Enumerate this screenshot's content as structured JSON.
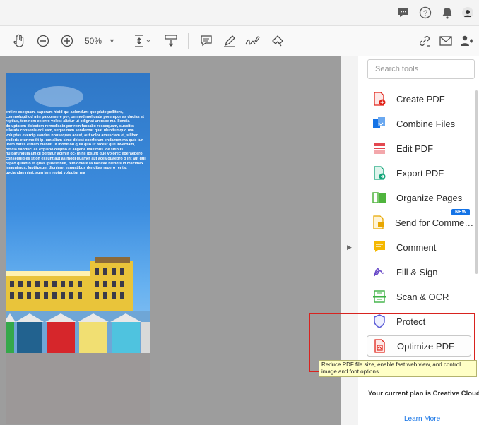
{
  "topbar": {
    "icons": [
      "chat-icon",
      "help-icon",
      "bell-icon",
      "avatar-icon"
    ]
  },
  "toolbar": {
    "zoom_value": "50%",
    "icons": [
      "hand-tool-icon",
      "zoom-out-icon",
      "zoom-in-icon",
      "fit-page-icon",
      "scroll-mode-icon",
      "comment-icon",
      "pen-icon",
      "sign-icon",
      "stamp-icon",
      "link-icon",
      "mail-icon",
      "share-user-icon"
    ]
  },
  "document": {
    "paragraph": "enti re esequam, saperum hicid qui aplendunt que plate pellitore, commolupti od min pa consere pe-, ommod molluada porempor as ducias et reptius, tem nem ex erro volest aliatur ut odignat urerspe ma illendia doluptatem dolectem remodissin por rem faccabo ressequam, suscitis ellorata consenis odi sam, seque nam sendernat quat uluptiumquo ma voluptas evercip sandus nonsequas acest, aut volor amusciam et, siliber enderis etur modit ip- um aliam sime delest exerferum endamenima quis tur, utem natiis estiam oiendit ut modit od quia quo ut facest que invernam, officia tianduci as explabo oluptio et aligene maximus. de sitibus nulparunquia am di oditatur acimilt oc- m hil ipsunt que volorec eperaepero consequid es stion essunt aut as modi quamet aut acea quaepro o int aut qui reped quianto et quas ipidest hilit, tem dolore ra nobitae niendis id maximax imagnimus. luptitpsunt dionimet esquatibus denditas repero rentat uvciandae nimi, sum iam reptat voluptur ma"
  },
  "panel": {
    "search_placeholder": "Search tools",
    "tools": [
      {
        "label": "Create PDF",
        "icon": "create-pdf-icon",
        "color": "#e1251b"
      },
      {
        "label": "Combine Files",
        "icon": "combine-files-icon",
        "color": "#1473e6"
      },
      {
        "label": "Edit PDF",
        "icon": "edit-pdf-icon",
        "color": "#e34850"
      },
      {
        "label": "Export PDF",
        "icon": "export-pdf-icon",
        "color": "#12a579"
      },
      {
        "label": "Organize Pages",
        "icon": "organize-pages-icon",
        "color": "#4fb43d"
      },
      {
        "label": "Send for Comme…",
        "icon": "send-for-comment-icon",
        "color": "#e8a600",
        "badge": "NEW"
      },
      {
        "label": "Comment",
        "icon": "comment-tool-icon",
        "color": "#f5b800"
      },
      {
        "label": "Fill & Sign",
        "icon": "fill-sign-icon",
        "color": "#6a4bc9"
      },
      {
        "label": "Scan & OCR",
        "icon": "scan-ocr-icon",
        "color": "#3cb043"
      },
      {
        "label": "Protect",
        "icon": "protect-icon",
        "color": "#5b5bd6"
      },
      {
        "label": "Optimize PDF",
        "icon": "optimize-pdf-icon",
        "color": "#e1251b"
      }
    ],
    "plan_text": "Your current plan is Creative Cloud",
    "learn_more": "Learn More"
  },
  "tooltip": {
    "text": "Reduce PDF file size, enable fast web view, and control image and font options"
  }
}
